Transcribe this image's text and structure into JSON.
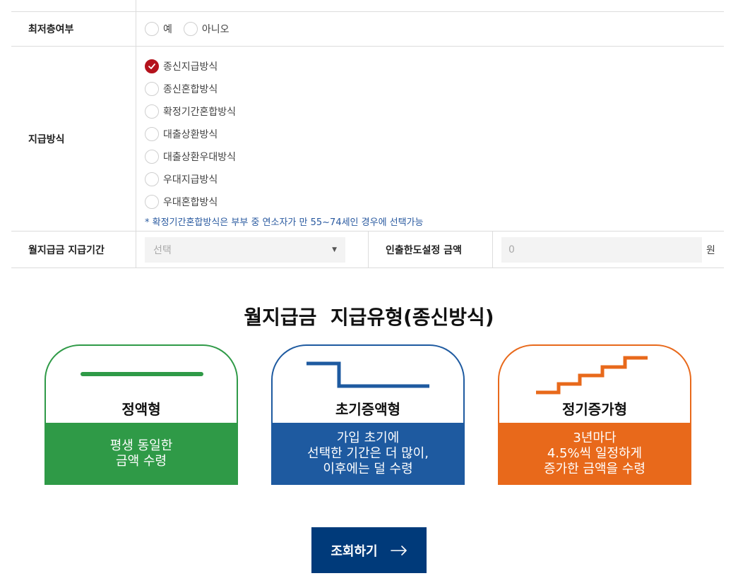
{
  "form": {
    "min_floor": {
      "label": "최저층여부",
      "options": [
        "예",
        "아니오"
      ],
      "selected": null
    },
    "payment_method": {
      "label": "지급방식",
      "options": [
        "종신지급방식",
        "종신혼합방식",
        "확정기간혼합방식",
        "대출상환방식",
        "대출상환우대방식",
        "우대지급방식",
        "우대혼합방식"
      ],
      "selected": "종신지급방식",
      "note": "* 확정기간혼합방식은 부부 중 연소자가 만 55~74세인 경우에 선택가능"
    },
    "monthly_period": {
      "label": "월지급금 지급기간",
      "select_value": "선택"
    },
    "withdraw_limit": {
      "label": "인출한도설정 금액",
      "value": "0",
      "unit": "원"
    }
  },
  "section": {
    "title": "월지급금  지급유형(종신방식)"
  },
  "cards": [
    {
      "title": "정액형",
      "desc": [
        "평생 동일한",
        "금액 수령"
      ],
      "color": "#2f9a47"
    },
    {
      "title": "초기증액형",
      "desc": [
        "가입 초기에",
        "선택한 기간은 더 많이,",
        "이후에는 덜 수령"
      ],
      "color": "#1e5aa0"
    },
    {
      "title": "정기증가형",
      "desc": [
        "3년마다",
        "4.5%씩 일정하게",
        "증가한 금액을 수령"
      ],
      "color": "#e8691b"
    }
  ],
  "search_button": {
    "label": "조회하기"
  },
  "colors": {
    "accent_red": "#b4121c",
    "note_blue": "#2a5aa0",
    "button_navy": "#003a7a"
  }
}
